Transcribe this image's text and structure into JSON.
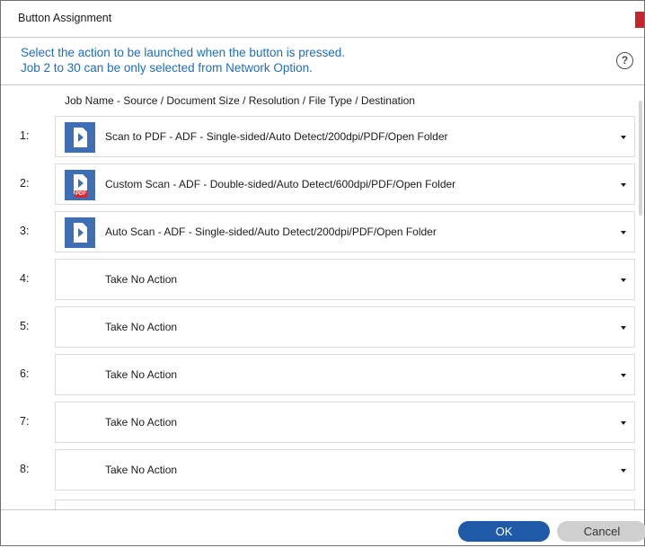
{
  "window": {
    "title": "Button Assignment"
  },
  "instructions": {
    "line1": "Select the action to be launched when the button is pressed.",
    "line2": "Job 2 to 30 can be only selected from Network Option.",
    "help_icon": "help-icon"
  },
  "list": {
    "header": "Job Name  -  Source / Document Size / Resolution / File Type / Destination",
    "rows": [
      {
        "number": "1:",
        "label": "Scan to PDF - ADF - Single-sided/Auto Detect/200dpi/PDF/Open Folder",
        "icon": "scan-play-icon"
      },
      {
        "number": "2:",
        "label": "Custom Scan - ADF - Double-sided/Auto Detect/600dpi/PDF/Open Folder",
        "icon": "scan-pdf-icon",
        "tag": "PDF"
      },
      {
        "number": "3:",
        "label": "Auto Scan - ADF - Single-sided/Auto Detect/200dpi/PDF/Open Folder",
        "icon": "scan-play-icon"
      },
      {
        "number": "4:",
        "label": "Take No Action"
      },
      {
        "number": "5:",
        "label": "Take No Action"
      },
      {
        "number": "6:",
        "label": "Take No Action"
      },
      {
        "number": "7:",
        "label": "Take No Action"
      },
      {
        "number": "8:",
        "label": "Take No Action"
      }
    ]
  },
  "footer": {
    "ok_label": "OK",
    "cancel_label": "Cancel"
  },
  "colors": {
    "accent_text": "#1f6dbf",
    "icon_blue": "#3e6fb5",
    "ok_button": "#1f5aa8",
    "cancel_button": "#cfcfcf",
    "close_red": "#c2272d"
  }
}
